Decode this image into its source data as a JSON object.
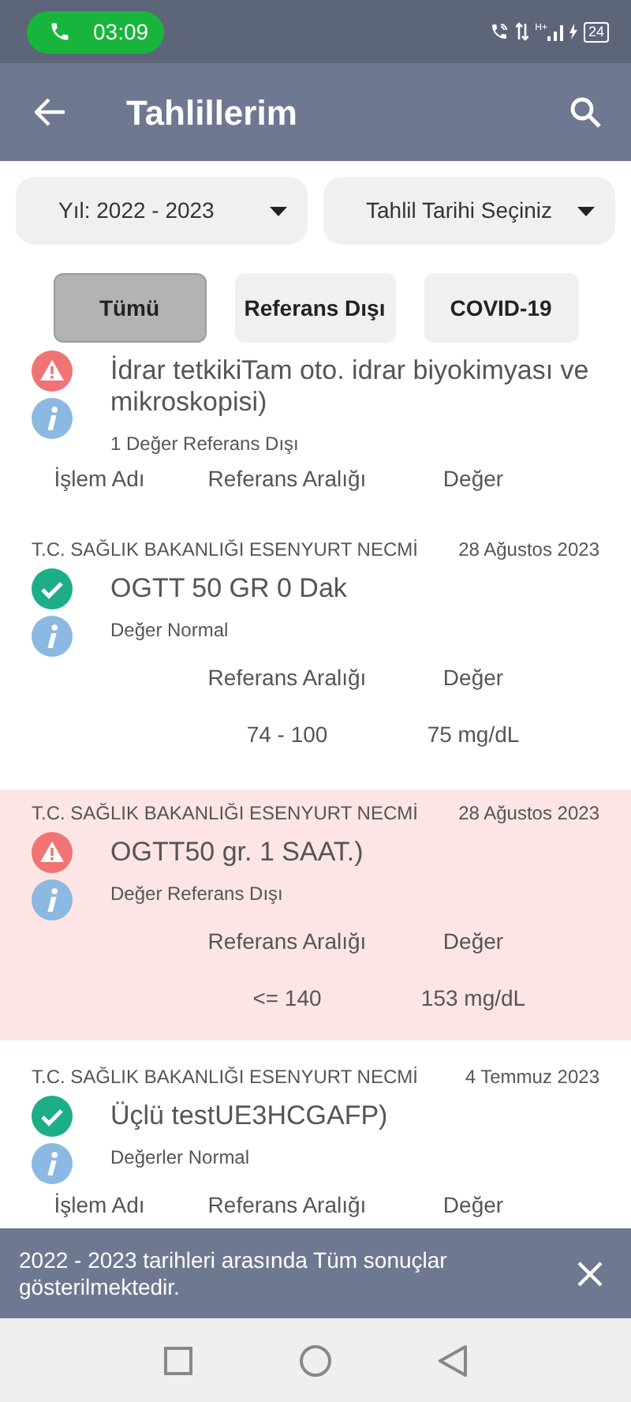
{
  "status_bar": {
    "call_time": "03:09",
    "network": "H+",
    "battery": "24"
  },
  "app_bar": {
    "title": "Tahlillerim"
  },
  "filters": [
    {
      "label": "Yıl: 2022 - 2023"
    },
    {
      "label": "Tahlil Tarihi Seçiniz"
    }
  ],
  "tabs": [
    {
      "label": "Tümü",
      "selected": true
    },
    {
      "label": "Referans Dışı",
      "selected": false
    },
    {
      "label": "COVID-19",
      "selected": false
    }
  ],
  "results": [
    {
      "kind": "warning",
      "highlighted": false,
      "title": "İdrar tetkikiTam oto. idrar biyokimyası ve mikroskopisi)",
      "summary": "1 Değer Referans Dışı",
      "columns": {
        "name": "İşlem Adı",
        "reference": "Referans Aralığı",
        "value": "Değer"
      }
    },
    {
      "hospital": "T.C. SAĞLIK BAKANLIĞI ESENYURT NECMİ",
      "date": "28 Ağustos 2023",
      "kind": "check",
      "highlighted": false,
      "title": "OGTT 50 GR 0 Dak",
      "summary": "Değer Normal",
      "columns": {
        "reference": "Referans Aralığı",
        "value": "Değer"
      },
      "row": {
        "reference": "74 - 100",
        "value": "75 mg/dL"
      }
    },
    {
      "hospital": "T.C. SAĞLIK BAKANLIĞI ESENYURT NECMİ",
      "date": "28 Ağustos 2023",
      "kind": "warning",
      "highlighted": true,
      "title": "OGTT50 gr. 1 SAAT.)",
      "summary": "Değer Referans Dışı",
      "columns": {
        "reference": "Referans Aralığı",
        "value": "Değer"
      },
      "row": {
        "reference": "<= 140",
        "value": "153 mg/dL"
      }
    },
    {
      "hospital": "T.C. SAĞLIK BAKANLIĞI ESENYURT NECMİ",
      "date": "4 Temmuz 2023",
      "kind": "check",
      "highlighted": false,
      "title": "Üçlü testUE3HCGAFP)",
      "summary": "Değerler Normal",
      "columns": {
        "name": "İşlem Adı",
        "reference": "Referans Aralığı",
        "value": "Değer"
      }
    }
  ],
  "banner": {
    "message": "2022 - 2023 tarihleri arasında Tüm sonuçlar gösterilmektedir."
  }
}
